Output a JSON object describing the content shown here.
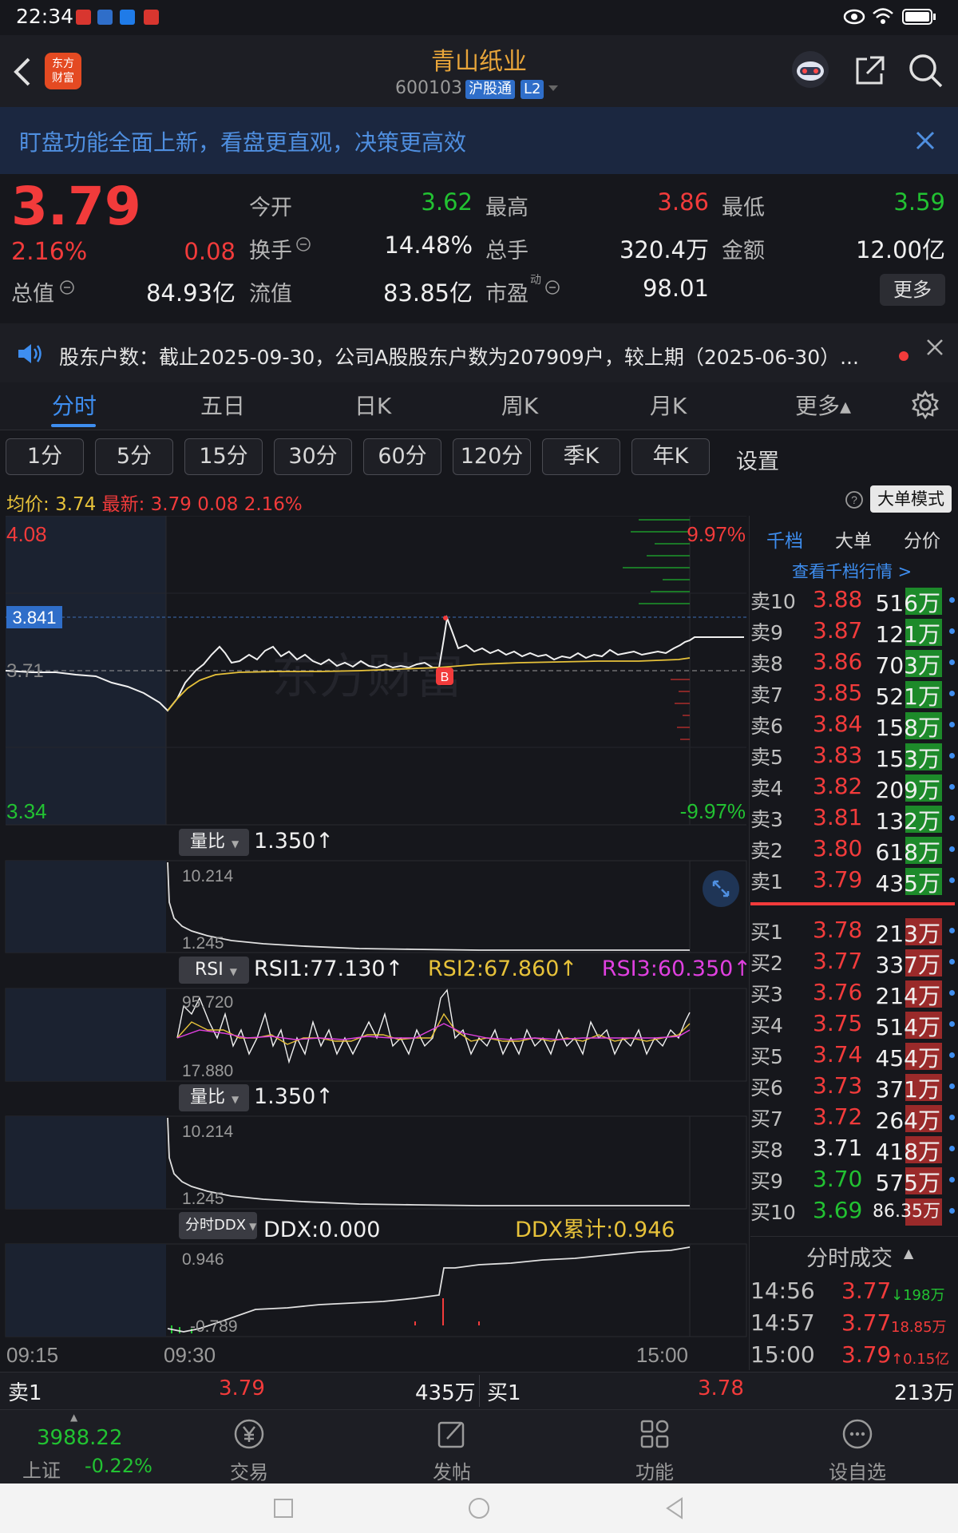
{
  "status_bar": {
    "time": "22:34"
  },
  "header": {
    "back_icon": "chevron-left-icon",
    "logo_text_1": "东方",
    "logo_text_2": "财富",
    "stock_name": "青山纸业",
    "stock_code": "600103",
    "tag_connect": "沪股通",
    "tag_level": "L2"
  },
  "banner": {
    "text": "盯盘功能全面上新，看盘更直观，决策更高效"
  },
  "quote": {
    "price": "3.79",
    "change_pct": "2.16%",
    "change": "0.08",
    "open_label": "今开",
    "open": "3.62",
    "high_label": "最高",
    "high": "3.86",
    "low_label": "最低",
    "low": "3.59",
    "turnover_label": "换手",
    "turnover": "14.48%",
    "volume_label": "总手",
    "volume": "320.4万",
    "amount_label": "金额",
    "amount": "12.00亿",
    "mcap_label": "总值",
    "mcap": "84.93亿",
    "float_label": "流值",
    "float": "83.85亿",
    "pe_label": "市盈",
    "pe_sup": "动",
    "pe": "98.01",
    "more_label": "更多"
  },
  "notice": {
    "text": "股东户数：截止2025-09-30，公司A股股东户数为207909户，较上期（2025-06-30）..."
  },
  "period_tabs": [
    "分时",
    "五日",
    "日K",
    "周K",
    "月K",
    "更多▴"
  ],
  "interval_chips": [
    "1分",
    "5分",
    "15分",
    "30分",
    "60分",
    "120分",
    "季K",
    "年K"
  ],
  "settings_label": "设置",
  "info_line": {
    "avg_label": "均价:",
    "avg": "3.74",
    "latest_label": "最新:",
    "latest": "3.79",
    "change": "0.08",
    "pct": "2.16%",
    "big_order_mode": "大单模式"
  },
  "main_chart": {
    "y_top": "4.08",
    "y_bottom": "3.34",
    "pct_top": "9.97%",
    "pct_bottom": "-9.97%",
    "ref_price": "3.71",
    "marker_price": "3.841",
    "marker_b": "B",
    "watermark": "东方财富"
  },
  "ind1": {
    "name": "量比",
    "value": "1.350",
    "max": "10.214",
    "min": "1.245"
  },
  "ind2": {
    "name": "RSI",
    "rsi1": "RSI1:77.130",
    "rsi2": "RSI2:67.860",
    "rsi3": "RSI3:60.350",
    "max": "95.720",
    "min": "17.880"
  },
  "ind3": {
    "name": "量比",
    "value": "1.350",
    "max": "10.214",
    "min": "1.245"
  },
  "ind4": {
    "name": "分时DDX",
    "ddx": "DDX:0.000",
    "ddx_sum": "DDX累计:0.946",
    "max": "0.946",
    "min": "-0.789"
  },
  "x_axis": {
    "t1": "09:15",
    "t2": "09:30",
    "t3": "15:00"
  },
  "orderbook": {
    "tabs": [
      "千档",
      "大单",
      "分价"
    ],
    "link": "查看千档行情 >",
    "asks": [
      {
        "label": "卖10",
        "price": "3.88",
        "vol": "516万"
      },
      {
        "label": "卖9",
        "price": "3.87",
        "vol": "121万"
      },
      {
        "label": "卖8",
        "price": "3.86",
        "vol": "703万"
      },
      {
        "label": "卖7",
        "price": "3.85",
        "vol": "521万"
      },
      {
        "label": "卖6",
        "price": "3.84",
        "vol": "158万"
      },
      {
        "label": "卖5",
        "price": "3.83",
        "vol": "153万"
      },
      {
        "label": "卖4",
        "price": "3.82",
        "vol": "209万"
      },
      {
        "label": "卖3",
        "price": "3.81",
        "vol": "132万"
      },
      {
        "label": "卖2",
        "price": "3.80",
        "vol": "618万"
      },
      {
        "label": "卖1",
        "price": "3.79",
        "vol": "435万"
      }
    ],
    "bids": [
      {
        "label": "买1",
        "price": "3.78",
        "vol": "213万"
      },
      {
        "label": "买2",
        "price": "3.77",
        "vol": "337万"
      },
      {
        "label": "买3",
        "price": "3.76",
        "vol": "214万"
      },
      {
        "label": "买4",
        "price": "3.75",
        "vol": "514万"
      },
      {
        "label": "买5",
        "price": "3.74",
        "vol": "454万"
      },
      {
        "label": "买6",
        "price": "3.73",
        "vol": "371万"
      },
      {
        "label": "买7",
        "price": "3.72",
        "vol": "264万"
      },
      {
        "label": "买8",
        "price": "3.71",
        "vol": "418万"
      },
      {
        "label": "买9",
        "price": "3.70",
        "vol": "575万"
      },
      {
        "label": "买10",
        "price": "3.69",
        "vol": "86.35万"
      }
    ],
    "ticks_title": "分时成交",
    "ticks": [
      {
        "time": "14:56",
        "price": "3.77",
        "vol": "↓198万"
      },
      {
        "time": "14:57",
        "price": "3.77",
        "vol": "18.85万"
      },
      {
        "time": "15:00",
        "price": "3.79",
        "vol": "↑0.15亿"
      }
    ]
  },
  "bottom_bar": {
    "ask_label": "卖1",
    "ask_price": "3.79",
    "ask_vol": "435万",
    "bid_label": "买1",
    "bid_price": "3.78",
    "bid_vol": "213万"
  },
  "nav": {
    "index_value": "3988.22",
    "index_name": "上证",
    "index_pct": "-0.22%",
    "trade": "交易",
    "post": "发帖",
    "func": "功能",
    "watch": "设自选"
  }
}
